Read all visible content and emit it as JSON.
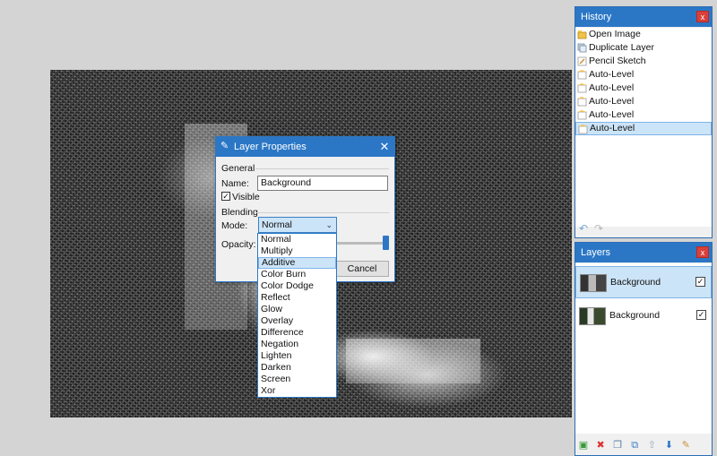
{
  "history": {
    "title": "History",
    "close_label": "x",
    "items": [
      {
        "label": "Open Image",
        "icon": "open-image-icon"
      },
      {
        "label": "Duplicate Layer",
        "icon": "duplicate-layer-icon"
      },
      {
        "label": "Pencil Sketch",
        "icon": "pencil-sketch-icon"
      },
      {
        "label": "Auto-Level",
        "icon": "auto-level-icon"
      },
      {
        "label": "Auto-Level",
        "icon": "auto-level-icon"
      },
      {
        "label": "Auto-Level",
        "icon": "auto-level-icon"
      },
      {
        "label": "Auto-Level",
        "icon": "auto-level-icon"
      },
      {
        "label": "Auto-Level",
        "icon": "auto-level-icon",
        "selected": true
      }
    ]
  },
  "layers": {
    "title": "Layers",
    "close_label": "x",
    "rows": [
      {
        "name": "Background",
        "visible": true,
        "selected": true
      },
      {
        "name": "Background",
        "visible": true,
        "selected": false
      }
    ]
  },
  "dialog": {
    "title": "Layer Properties",
    "close_label": "✕",
    "general_label": "General",
    "name_label": "Name:",
    "name_value": "Background",
    "visible_label": "Visible",
    "visible_checked": true,
    "blending_label": "Blending",
    "mode_label": "Mode:",
    "mode_value": "Normal",
    "opacity_label": "Opacity:",
    "opacity_fraction": 1.0,
    "cancel_label": "Cancel"
  },
  "mode_options": [
    "Normal",
    "Multiply",
    "Additive",
    "Color Burn",
    "Color Dodge",
    "Reflect",
    "Glow",
    "Overlay",
    "Difference",
    "Negation",
    "Lighten",
    "Darken",
    "Screen",
    "Xor"
  ],
  "mode_hovered": "Additive",
  "colors": {
    "titlebar": "#2b77c6",
    "selection": "#cce4f7",
    "close_button": "#d9403a"
  }
}
